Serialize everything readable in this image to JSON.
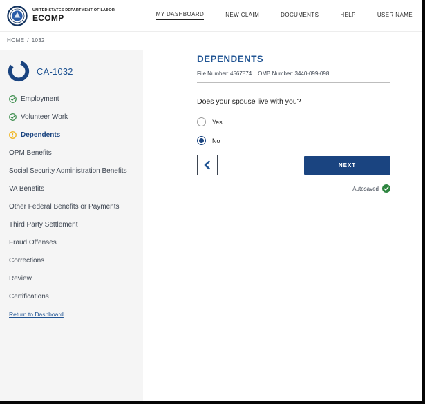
{
  "colors": {
    "primary_blue": "#205493",
    "dark_blue": "#1a4480",
    "success_green": "#2e8540",
    "warning_gold": "#f0b41c",
    "sidebar_bg": "#f5f5f5"
  },
  "header": {
    "agency": "UNITED STATES DEPARTMENT OF LABOR",
    "app_name": "ECOMP",
    "logo_icon": "dol-seal",
    "nav": [
      {
        "label": "MY DASHBOARD",
        "active": true
      },
      {
        "label": "NEW CLAIM",
        "active": false
      },
      {
        "label": "DOCUMENTS",
        "active": false
      },
      {
        "label": "HELP",
        "active": false
      },
      {
        "label": "USER NAME",
        "active": false
      }
    ]
  },
  "breadcrumb": {
    "items": [
      "HOME",
      "1032"
    ],
    "separator": "/"
  },
  "sidebar": {
    "form_code": "CA-1032",
    "progress_icon": "progress-ring",
    "items": [
      {
        "label": "Employment",
        "status": "complete"
      },
      {
        "label": "Volunteer Work",
        "status": "complete"
      },
      {
        "label": "Dependents",
        "status": "current"
      },
      {
        "label": "OPM Benefits",
        "status": "none"
      },
      {
        "label": "Social Security Administration Benefits",
        "status": "none"
      },
      {
        "label": "VA Benefits",
        "status": "none"
      },
      {
        "label": "Other Federal Benefits or Payments",
        "status": "none"
      },
      {
        "label": "Third Party Settlement",
        "status": "none"
      },
      {
        "label": "Fraud Offenses",
        "status": "none"
      },
      {
        "label": "Corrections",
        "status": "none"
      },
      {
        "label": "Review",
        "status": "none"
      },
      {
        "label": "Certifications",
        "status": "none"
      }
    ],
    "return_link": "Return to Dashboard"
  },
  "main": {
    "title": "DEPENDENTS",
    "file_number": "File Number: 4567874",
    "omb_number": "OMB Number: 3440-099-098",
    "question": "Does your spouse live with you?",
    "options": [
      {
        "label": "Yes",
        "selected": false
      },
      {
        "label": "No",
        "selected": true
      }
    ],
    "next_label": "NEXT",
    "autosaved_label": "Autosaved"
  }
}
